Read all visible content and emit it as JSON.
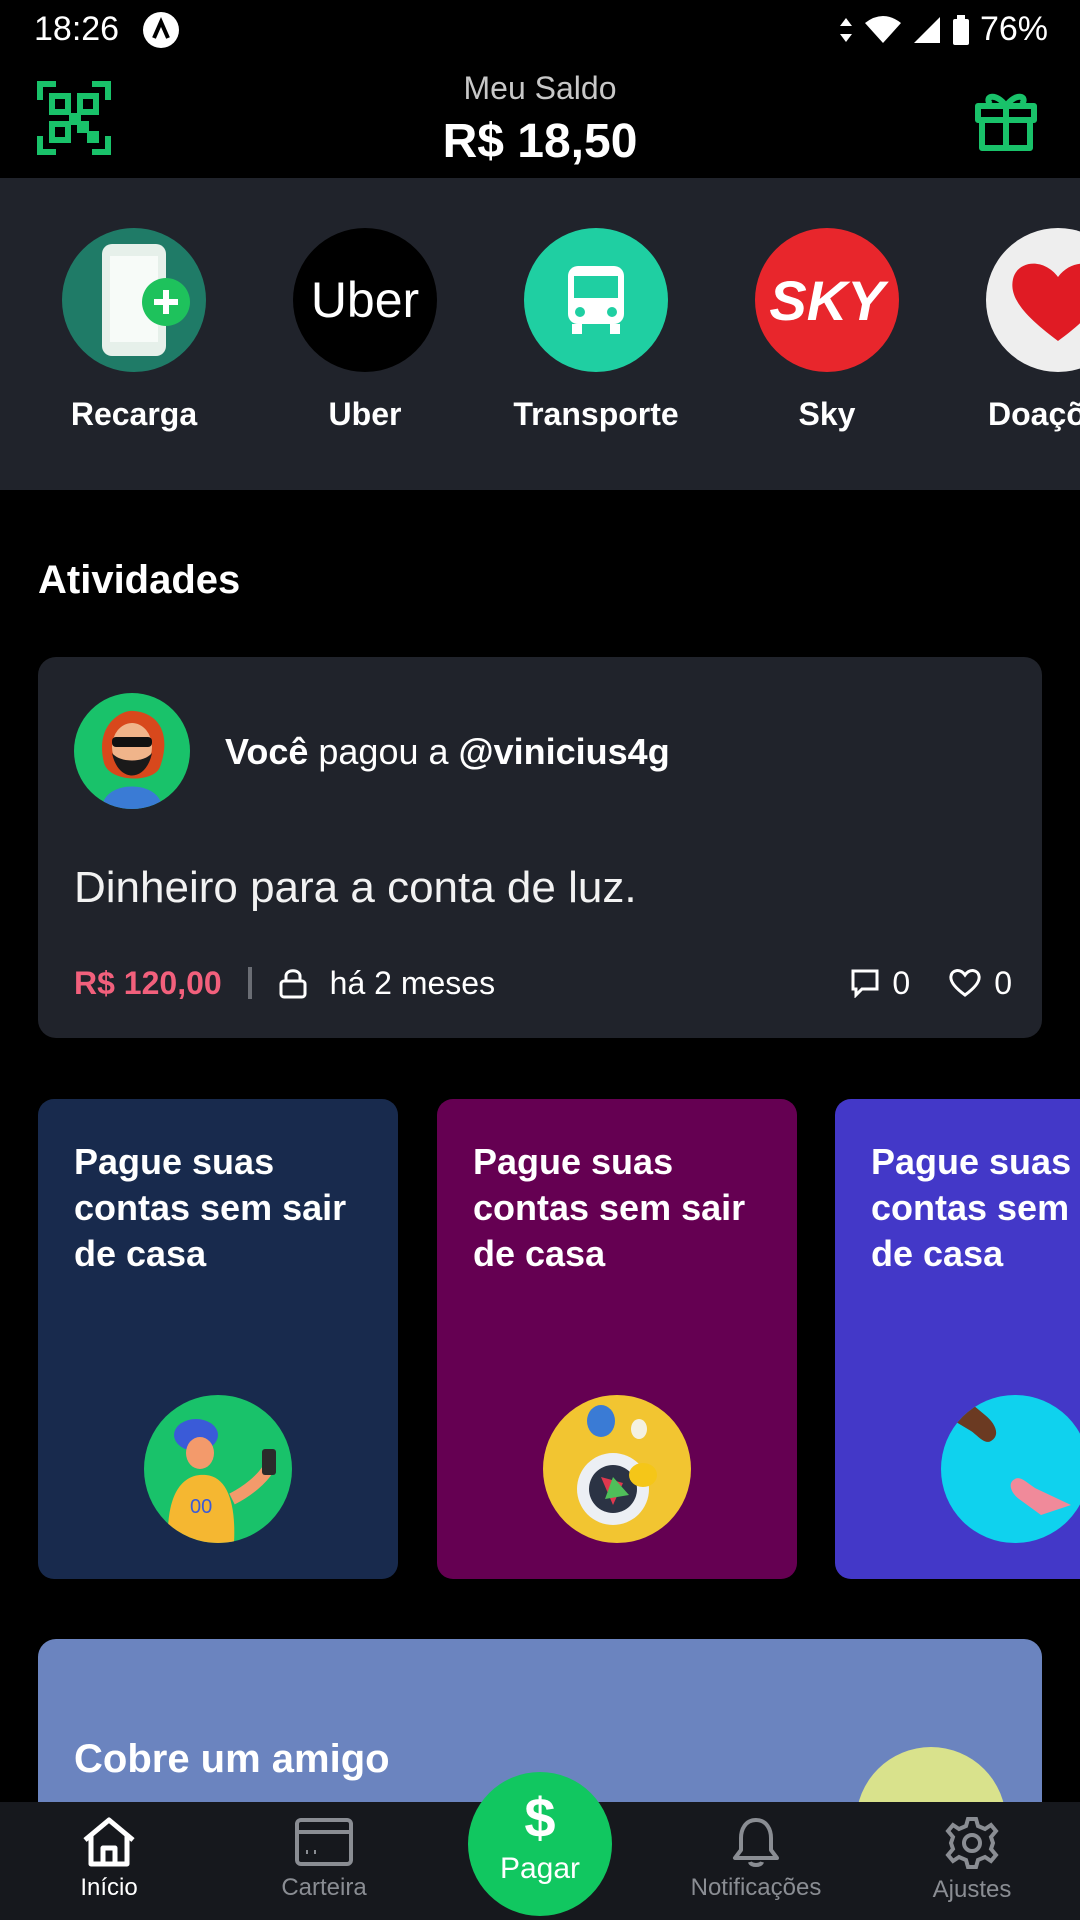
{
  "status": {
    "time": "18:26",
    "battery": "76%"
  },
  "header": {
    "balance_label": "Meu Saldo",
    "balance_value": "R$ 18,50"
  },
  "shortcuts": [
    {
      "label": "Recarga",
      "icon": "phone-plus-icon",
      "color": "#1f7b67"
    },
    {
      "label": "Uber",
      "icon": "uber-logo",
      "color": "#000000",
      "logo_text": "Uber"
    },
    {
      "label": "Transporte",
      "icon": "bus-icon",
      "color": "#1fcfa2"
    },
    {
      "label": "Sky",
      "icon": "sky-logo",
      "color": "#e8262c",
      "logo_text": "SKY"
    },
    {
      "label": "Doaçõ",
      "icon": "heart-icon",
      "color": "#eeeeee"
    }
  ],
  "activities": {
    "title": "Atividades",
    "item": {
      "actor": "Você",
      "verb": " pagou a ",
      "target": "@vinicius4g",
      "message": "Dinheiro para a conta de luz.",
      "amount": "R$ 120,00",
      "time": "há 2 meses",
      "comments": "0",
      "likes": "0"
    }
  },
  "promos": [
    {
      "title": "Pague suas contas sem sair de casa",
      "bg": "#182a4d",
      "circle": "#19c26a"
    },
    {
      "title": "Pague suas contas sem sair de casa",
      "bg": "#650052",
      "circle": "#f2c531"
    },
    {
      "title": "Pague suas contas sem sair de casa",
      "bg": "#4338c8",
      "circle": "#0fd2ee"
    }
  ],
  "cobre": {
    "title": "Cobre um amigo"
  },
  "nav": {
    "inicio": "Início",
    "carteira": "Carteira",
    "pagar": "Pagar",
    "pagar_symbol": "$",
    "notificacoes": "Notificações",
    "ajustes": "Ajustes"
  }
}
